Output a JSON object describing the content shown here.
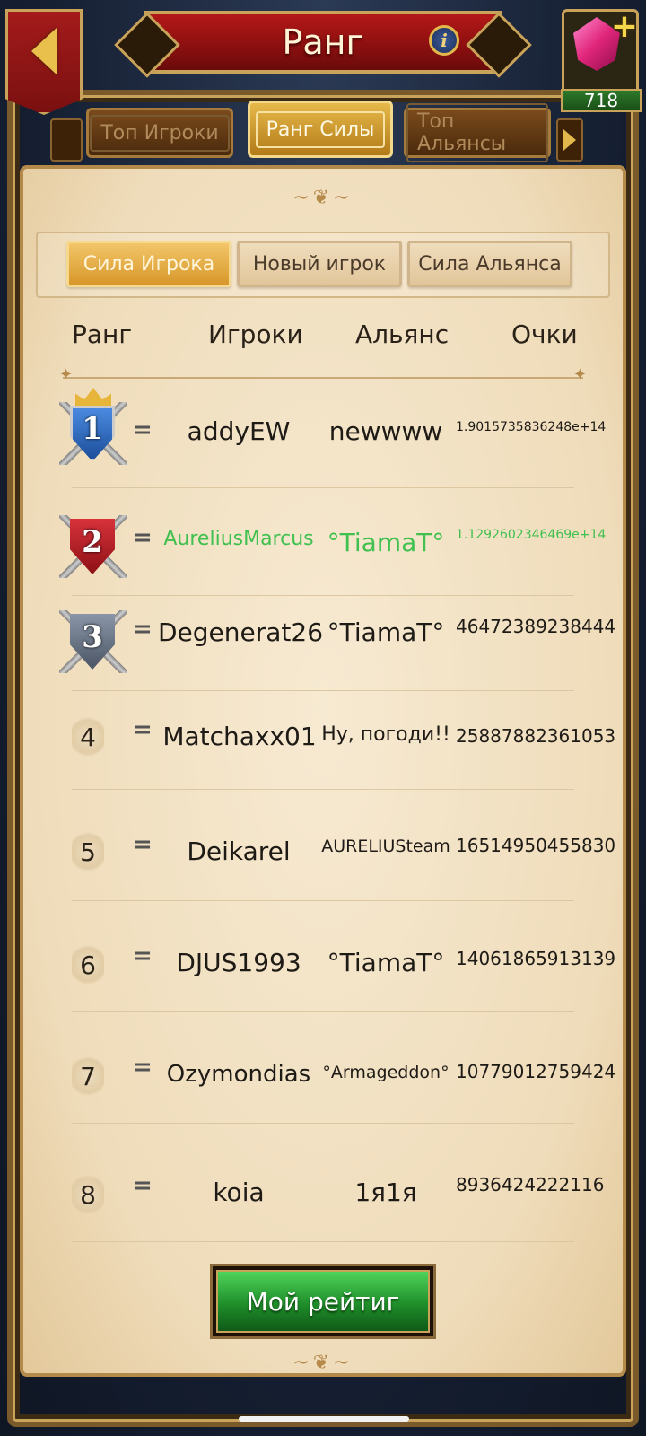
{
  "header": {
    "title": "Ранг",
    "gem_count": "718"
  },
  "tabs": [
    {
      "label": "Топ Игроки",
      "active": false
    },
    {
      "label": "Ранг Силы",
      "active": true
    },
    {
      "label": "Топ Альянсы",
      "active": false
    }
  ],
  "subtabs": [
    {
      "label": "Сила Игрока",
      "active": true
    },
    {
      "label": "Новый игрок",
      "active": false
    },
    {
      "label": "Сила Альянса",
      "active": false
    }
  ],
  "columns": {
    "rank": "Ранг",
    "players": "Игроки",
    "alliance": "Альянс",
    "points": "Очки"
  },
  "rows": [
    {
      "rank": "1",
      "change": "=",
      "player": "addyEW",
      "alliance": "newwww",
      "points": "1.9015735836248e+14"
    },
    {
      "rank": "2",
      "change": "=",
      "player": "AureliusMarcus",
      "alliance": "°TiamaT°",
      "points": "1.1292602346469e+14",
      "highlight": true
    },
    {
      "rank": "3",
      "change": "=",
      "player": "Degenerat26",
      "alliance": "°TiamaT°",
      "points": "46472389238444"
    },
    {
      "rank": "4",
      "change": "=",
      "player": "Matchaxx01",
      "alliance": "Ну, погоди!!",
      "points": "25887882361053"
    },
    {
      "rank": "5",
      "change": "=",
      "player": "Deikarel",
      "alliance": "AURELIUSteam",
      "points": "16514950455830"
    },
    {
      "rank": "6",
      "change": "=",
      "player": "DJUS1993",
      "alliance": "°TiamaT°",
      "points": "14061865913139"
    },
    {
      "rank": "7",
      "change": "=",
      "player": "Ozymondias",
      "alliance": "°Armageddon°",
      "points": "10779012759424"
    },
    {
      "rank": "8",
      "change": "=",
      "player": "koia",
      "alliance": "1я1я",
      "points": "8936424222116"
    }
  ],
  "buttons": {
    "my_rating": "Мой рейтиг"
  },
  "colors": {
    "highlight": "#3fc04f",
    "title_banner": "#b41818",
    "active_tab": "#e6b94a"
  }
}
